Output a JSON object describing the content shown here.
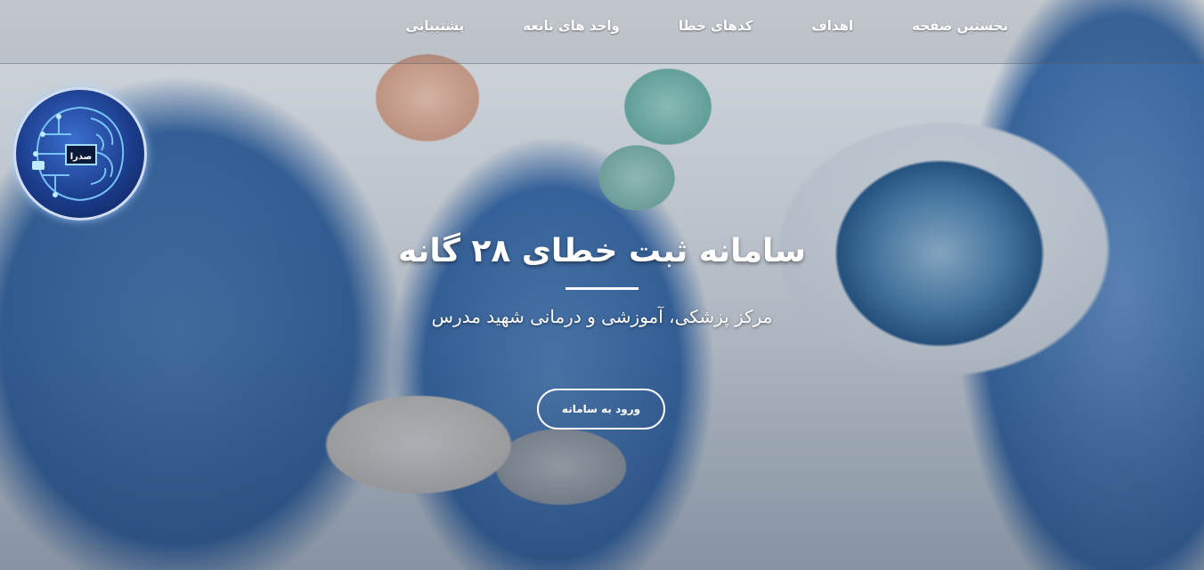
{
  "nav": {
    "items": [
      {
        "label": "نخستین صفحه"
      },
      {
        "label": "اهداف"
      },
      {
        "label": "کدهای خطا"
      },
      {
        "label": "واحد های تابعه"
      },
      {
        "label": "پشتیبانی"
      }
    ]
  },
  "logo": {
    "text": "صدرا",
    "icon": "brain-circuit-icon"
  },
  "hero": {
    "title": "سامانه ثبت خطای ۲۸ گانه",
    "subtitle": "مرکز پزشکی، آموزشی و درمانی شهید مدرس",
    "login_button": "ورود به سامانه",
    "background_image": "surgeons-operating-room"
  },
  "colors": {
    "text": "#ffffff",
    "hero_dark": "#1f3d66"
  }
}
